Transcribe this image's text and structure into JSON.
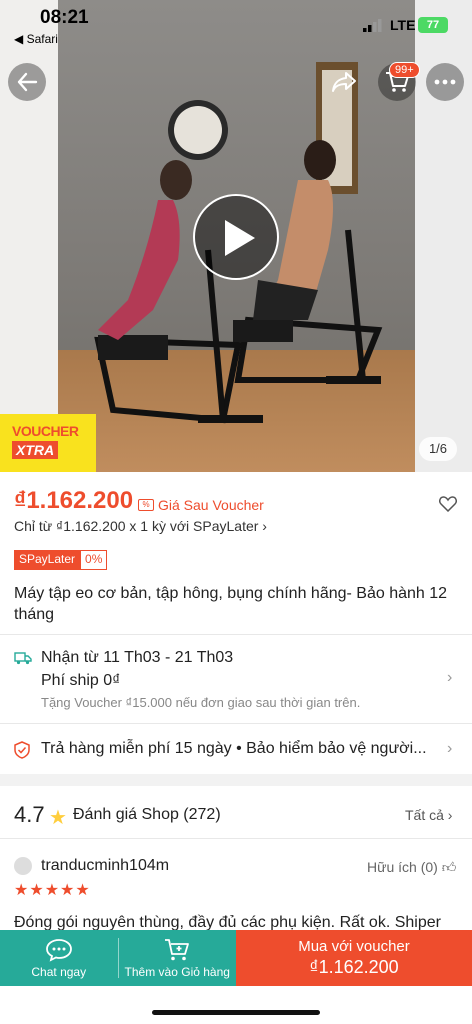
{
  "status": {
    "time": "08:21",
    "back_app": "◀ Safari",
    "network": "LTE",
    "battery": "77"
  },
  "hero": {
    "cart_badge": "99+",
    "voucher_line1": "VOUCHER",
    "voucher_line2": "XTRA",
    "page_counter": "1/6"
  },
  "price": {
    "amount": "₫1.162.200",
    "label": "Giá Sau Voucher",
    "installment": "Chỉ từ ₫1.162.200 x 1 kỳ với SPayLater ›",
    "badge_name": "SPayLater",
    "badge_rate": "0%"
  },
  "product": {
    "title": "Máy tập eo cơ bản, tập hông, bụng chính hãng- Bảo hành 12 tháng"
  },
  "shipping": {
    "line1": "Nhận từ 11 Th03 - 21 Th03",
    "line2": "Phí ship 0₫",
    "line3": "Tặng Voucher ₫15.000 nếu đơn giao sau thời gian trên."
  },
  "guarantee": {
    "text": "Trả hàng miễn phí 15 ngày  •  Bảo hiểm bảo vệ người..."
  },
  "rating": {
    "score": "4.7",
    "label": "Đánh giá Shop (272)",
    "see_all": "Tất cả ›"
  },
  "review": {
    "reviewer": "tranducminh104m",
    "helpful": "Hữu ích (0)",
    "stars": "★★★★★",
    "text": "Đóng gói nguyên thùng, đầy đủ các phụ kiện. Rất ok. Shiper"
  },
  "bottom": {
    "chat": "Chat ngay",
    "add_cart": "Thêm vào Giỏ hàng",
    "buy_line1": "Mua với voucher",
    "buy_line2": "₫1.162.200"
  },
  "colors": {
    "accent": "#ee4d2d",
    "teal": "#26aa99",
    "star": "#ffce3d"
  },
  "icons": [
    "back-arrow-icon",
    "share-icon",
    "cart-icon",
    "more-icon",
    "play-icon",
    "heart-icon",
    "truck-icon",
    "shield-icon",
    "chat-icon",
    "add-cart-icon"
  ]
}
